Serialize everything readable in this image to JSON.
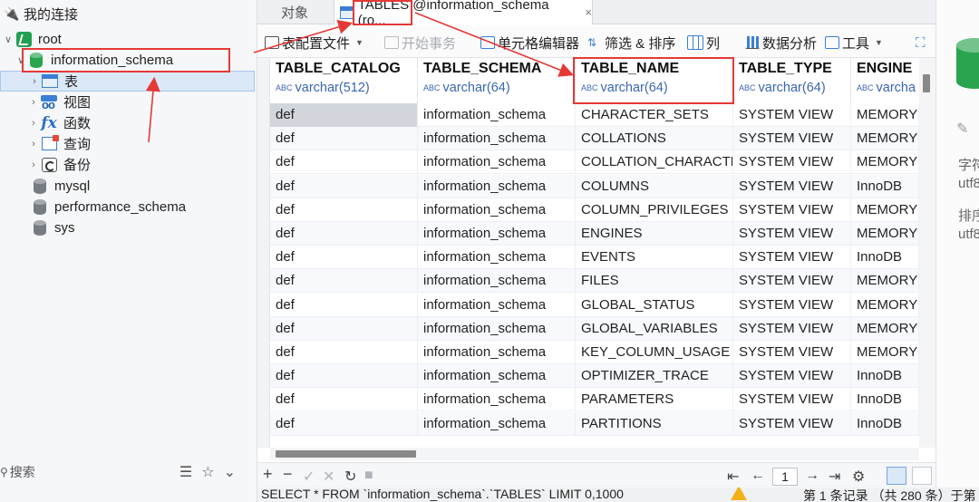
{
  "sidebar": {
    "header": "我的连接",
    "connection": "root",
    "database_open": "information_schema",
    "db_children": [
      "表",
      "视图",
      "函数",
      "查询",
      "备份"
    ],
    "other_dbs": [
      "mysql",
      "performance_schema",
      "sys"
    ],
    "search_placeholder": "搜索"
  },
  "tabs": {
    "objects": "对象",
    "active": "TABLES @information_schema (ro...",
    "close": "×"
  },
  "toolbar": {
    "table_config": "表配置文件",
    "begin_tx": "开始事务",
    "cell_editor": "单元格编辑器",
    "filter_sort": "筛选 & 排序",
    "columns": "列",
    "analysis": "数据分析",
    "tools": "工具"
  },
  "grid": {
    "columns": [
      {
        "name": "TABLE_CATALOG",
        "type": "varchar(512)"
      },
      {
        "name": "TABLE_SCHEMA",
        "type": "varchar(64)"
      },
      {
        "name": "TABLE_NAME",
        "type": "varchar(64)"
      },
      {
        "name": "TABLE_TYPE",
        "type": "varchar(64)"
      },
      {
        "name": "ENGINE",
        "type": "varcha"
      }
    ],
    "rows": [
      [
        "def",
        "information_schema",
        "CHARACTER_SETS",
        "SYSTEM VIEW",
        "MEMORY"
      ],
      [
        "def",
        "information_schema",
        "COLLATIONS",
        "SYSTEM VIEW",
        "MEMORY"
      ],
      [
        "def",
        "information_schema",
        "COLLATION_CHARACTE",
        "SYSTEM VIEW",
        "MEMORY"
      ],
      [
        "def",
        "information_schema",
        "COLUMNS",
        "SYSTEM VIEW",
        "InnoDB"
      ],
      [
        "def",
        "information_schema",
        "COLUMN_PRIVILEGES",
        "SYSTEM VIEW",
        "MEMORY"
      ],
      [
        "def",
        "information_schema",
        "ENGINES",
        "SYSTEM VIEW",
        "MEMORY"
      ],
      [
        "def",
        "information_schema",
        "EVENTS",
        "SYSTEM VIEW",
        "InnoDB"
      ],
      [
        "def",
        "information_schema",
        "FILES",
        "SYSTEM VIEW",
        "MEMORY"
      ],
      [
        "def",
        "information_schema",
        "GLOBAL_STATUS",
        "SYSTEM VIEW",
        "MEMORY"
      ],
      [
        "def",
        "information_schema",
        "GLOBAL_VARIABLES",
        "SYSTEM VIEW",
        "MEMORY"
      ],
      [
        "def",
        "information_schema",
        "KEY_COLUMN_USAGE",
        "SYSTEM VIEW",
        "MEMORY"
      ],
      [
        "def",
        "information_schema",
        "OPTIMIZER_TRACE",
        "SYSTEM VIEW",
        "InnoDB"
      ],
      [
        "def",
        "information_schema",
        "PARAMETERS",
        "SYSTEM VIEW",
        "InnoDB"
      ],
      [
        "def",
        "information_schema",
        "PARTITIONS",
        "SYSTEM VIEW",
        "InnoDB"
      ]
    ]
  },
  "pagination": {
    "page": "1"
  },
  "status": {
    "sql": "SELECT * FROM `information_schema`.`TABLES` LIMIT 0,1000",
    "records": "第 1 条记录 （共 280 条）于第"
  },
  "right_panel": {
    "line1": "字符",
    "line2": "utf8",
    "line3": "排序",
    "line4": "utf8"
  },
  "colors": {
    "accent": "#2aa44f",
    "highlight": "#e53935",
    "selection": "#dbe8f8"
  }
}
